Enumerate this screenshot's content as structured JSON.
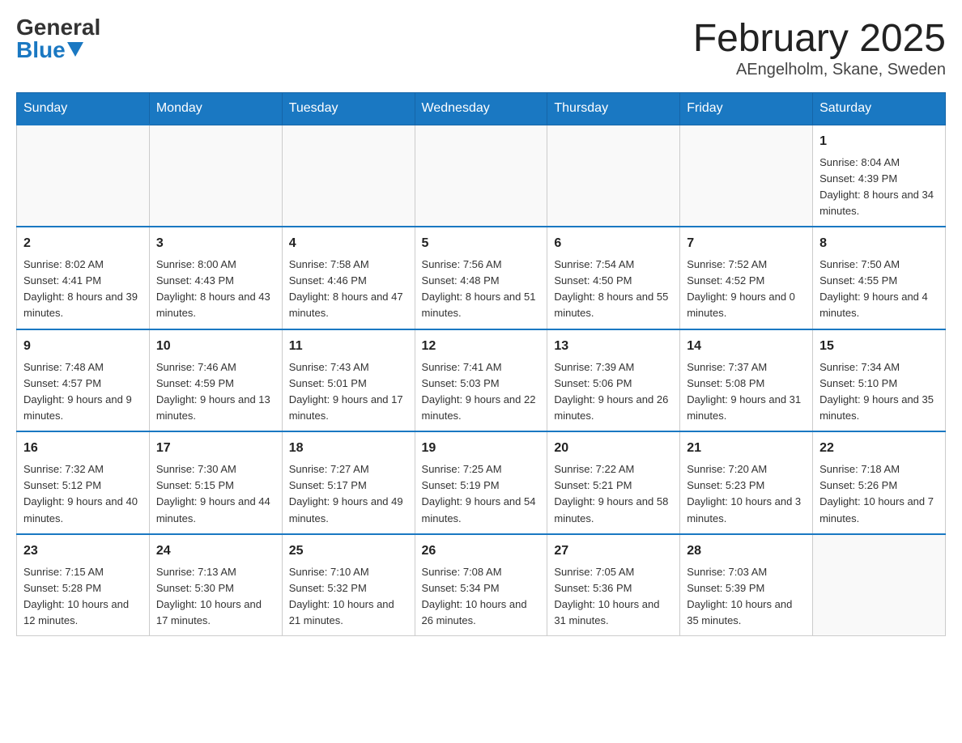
{
  "header": {
    "logo_general": "General",
    "logo_blue": "Blue",
    "month_title": "February 2025",
    "location": "AEngelholm, Skane, Sweden"
  },
  "days_of_week": [
    "Sunday",
    "Monday",
    "Tuesday",
    "Wednesday",
    "Thursday",
    "Friday",
    "Saturday"
  ],
  "weeks": [
    {
      "days": [
        {
          "date": "",
          "info": ""
        },
        {
          "date": "",
          "info": ""
        },
        {
          "date": "",
          "info": ""
        },
        {
          "date": "",
          "info": ""
        },
        {
          "date": "",
          "info": ""
        },
        {
          "date": "",
          "info": ""
        },
        {
          "date": "1",
          "info": "Sunrise: 8:04 AM\nSunset: 4:39 PM\nDaylight: 8 hours and 34 minutes."
        }
      ]
    },
    {
      "days": [
        {
          "date": "2",
          "info": "Sunrise: 8:02 AM\nSunset: 4:41 PM\nDaylight: 8 hours and 39 minutes."
        },
        {
          "date": "3",
          "info": "Sunrise: 8:00 AM\nSunset: 4:43 PM\nDaylight: 8 hours and 43 minutes."
        },
        {
          "date": "4",
          "info": "Sunrise: 7:58 AM\nSunset: 4:46 PM\nDaylight: 8 hours and 47 minutes."
        },
        {
          "date": "5",
          "info": "Sunrise: 7:56 AM\nSunset: 4:48 PM\nDaylight: 8 hours and 51 minutes."
        },
        {
          "date": "6",
          "info": "Sunrise: 7:54 AM\nSunset: 4:50 PM\nDaylight: 8 hours and 55 minutes."
        },
        {
          "date": "7",
          "info": "Sunrise: 7:52 AM\nSunset: 4:52 PM\nDaylight: 9 hours and 0 minutes."
        },
        {
          "date": "8",
          "info": "Sunrise: 7:50 AM\nSunset: 4:55 PM\nDaylight: 9 hours and 4 minutes."
        }
      ]
    },
    {
      "days": [
        {
          "date": "9",
          "info": "Sunrise: 7:48 AM\nSunset: 4:57 PM\nDaylight: 9 hours and 9 minutes."
        },
        {
          "date": "10",
          "info": "Sunrise: 7:46 AM\nSunset: 4:59 PM\nDaylight: 9 hours and 13 minutes."
        },
        {
          "date": "11",
          "info": "Sunrise: 7:43 AM\nSunset: 5:01 PM\nDaylight: 9 hours and 17 minutes."
        },
        {
          "date": "12",
          "info": "Sunrise: 7:41 AM\nSunset: 5:03 PM\nDaylight: 9 hours and 22 minutes."
        },
        {
          "date": "13",
          "info": "Sunrise: 7:39 AM\nSunset: 5:06 PM\nDaylight: 9 hours and 26 minutes."
        },
        {
          "date": "14",
          "info": "Sunrise: 7:37 AM\nSunset: 5:08 PM\nDaylight: 9 hours and 31 minutes."
        },
        {
          "date": "15",
          "info": "Sunrise: 7:34 AM\nSunset: 5:10 PM\nDaylight: 9 hours and 35 minutes."
        }
      ]
    },
    {
      "days": [
        {
          "date": "16",
          "info": "Sunrise: 7:32 AM\nSunset: 5:12 PM\nDaylight: 9 hours and 40 minutes."
        },
        {
          "date": "17",
          "info": "Sunrise: 7:30 AM\nSunset: 5:15 PM\nDaylight: 9 hours and 44 minutes."
        },
        {
          "date": "18",
          "info": "Sunrise: 7:27 AM\nSunset: 5:17 PM\nDaylight: 9 hours and 49 minutes."
        },
        {
          "date": "19",
          "info": "Sunrise: 7:25 AM\nSunset: 5:19 PM\nDaylight: 9 hours and 54 minutes."
        },
        {
          "date": "20",
          "info": "Sunrise: 7:22 AM\nSunset: 5:21 PM\nDaylight: 9 hours and 58 minutes."
        },
        {
          "date": "21",
          "info": "Sunrise: 7:20 AM\nSunset: 5:23 PM\nDaylight: 10 hours and 3 minutes."
        },
        {
          "date": "22",
          "info": "Sunrise: 7:18 AM\nSunset: 5:26 PM\nDaylight: 10 hours and 7 minutes."
        }
      ]
    },
    {
      "days": [
        {
          "date": "23",
          "info": "Sunrise: 7:15 AM\nSunset: 5:28 PM\nDaylight: 10 hours and 12 minutes."
        },
        {
          "date": "24",
          "info": "Sunrise: 7:13 AM\nSunset: 5:30 PM\nDaylight: 10 hours and 17 minutes."
        },
        {
          "date": "25",
          "info": "Sunrise: 7:10 AM\nSunset: 5:32 PM\nDaylight: 10 hours and 21 minutes."
        },
        {
          "date": "26",
          "info": "Sunrise: 7:08 AM\nSunset: 5:34 PM\nDaylight: 10 hours and 26 minutes."
        },
        {
          "date": "27",
          "info": "Sunrise: 7:05 AM\nSunset: 5:36 PM\nDaylight: 10 hours and 31 minutes."
        },
        {
          "date": "28",
          "info": "Sunrise: 7:03 AM\nSunset: 5:39 PM\nDaylight: 10 hours and 35 minutes."
        },
        {
          "date": "",
          "info": ""
        }
      ]
    }
  ]
}
